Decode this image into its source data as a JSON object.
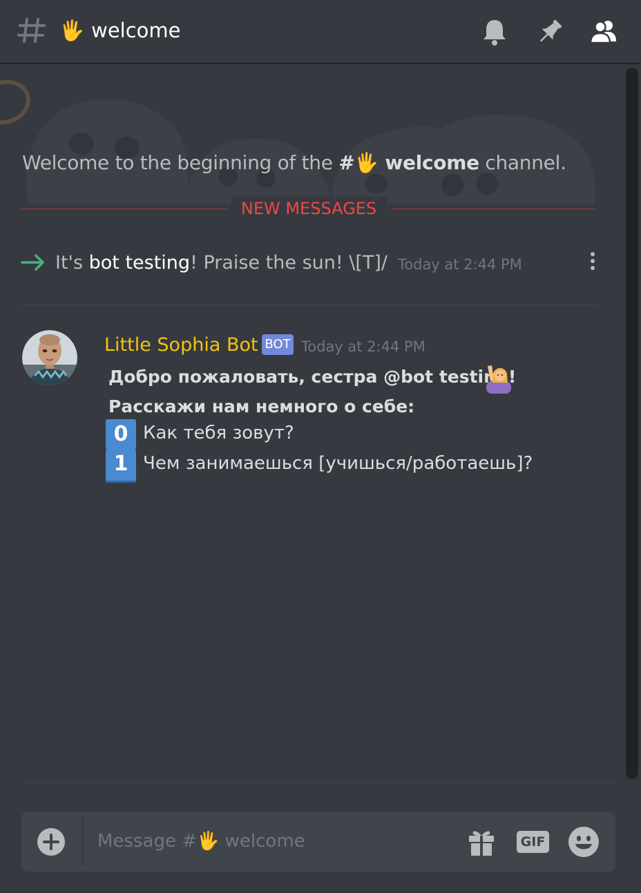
{
  "header": {
    "channel_emoji": "🖐",
    "channel_name": "welcome"
  },
  "intro": {
    "prefix": "Welcome to the beginning of the ",
    "channel": "#🖐 welcome",
    "suffix": " channel."
  },
  "divider": {
    "label": "NEW MESSAGES"
  },
  "system_message": {
    "before": "It's ",
    "user": "bot testing",
    "after": "! Praise the sun! \\[T]/",
    "time": "Today at 2:44 PM"
  },
  "bot_message": {
    "author": "Little Sophia Bot",
    "tag": "BOT",
    "time": "Today at 2:44 PM",
    "line1": "Добро пожаловать, сестра @bot testing!",
    "line2": "Расскажи нам немного о себе:",
    "items": [
      {
        "key": "0",
        "text": "Как тебя зовут?"
      },
      {
        "key": "1",
        "text": "Чем занимаешься [учишься/работаешь]?"
      }
    ]
  },
  "composer": {
    "placeholder": "Message #🖐 welcome",
    "gif_label": "GIF"
  },
  "colors": {
    "background": "#36393f",
    "author": "#f1c40f",
    "bot_tag": "#7289da",
    "new_messages": "#f04747",
    "join_arrow": "#43b581"
  }
}
